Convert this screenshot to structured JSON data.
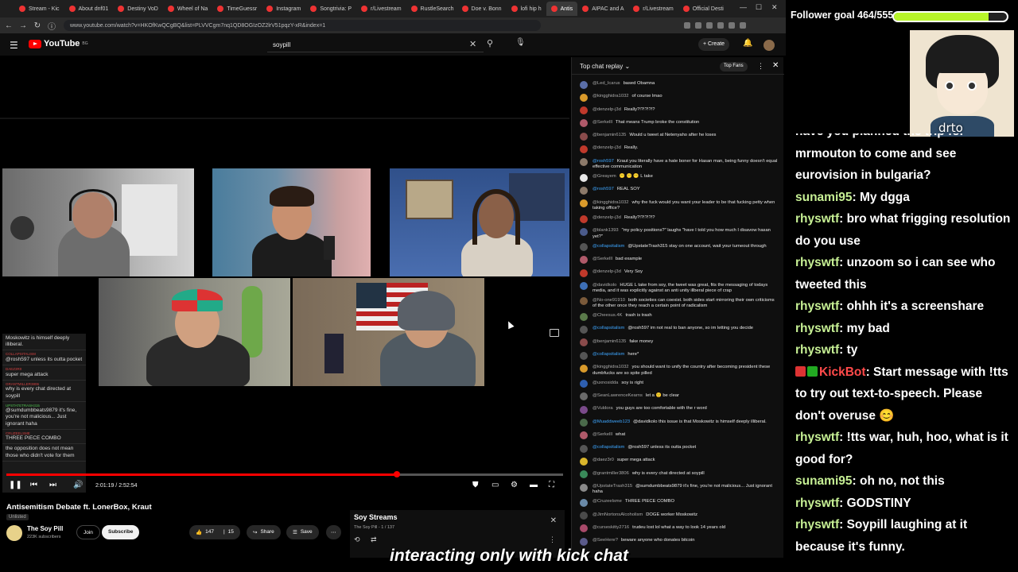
{
  "browser": {
    "tabs": [
      "Stream - Kic",
      "About dnf01",
      "Destiny VoD",
      "Wheel of Na",
      "TimeGuessr",
      "Instagram",
      "Songtrivia: P",
      "r/Livestream",
      "RustleSearch",
      "Doe v. Bonn",
      "lofi hip h",
      "Antis",
      "AIPAC and A",
      "r/Livestream",
      "Official Desti"
    ],
    "active_tab_index": 11,
    "url": "www.youtube.com/watch?v=HKOfKwQCgBQ&list=PLVVCgm7nq1QD8OGIzOZ2lrV51pqzY-xR&index=1"
  },
  "youtube": {
    "logo": "YouTube",
    "country": "BG",
    "search_value": "soypill",
    "create_label": "Create"
  },
  "video": {
    "time_current": "2:01:19",
    "time_total": "2:52:54",
    "progress": 0.701,
    "overlay_chat": [
      {
        "user": "",
        "text": "Moskowitz is himself deeply illiberal.",
        "member": false
      },
      {
        "user": "COLLAPSITALISM",
        "text": "@rosh597 unless its outta pocket",
        "member": false
      },
      {
        "user": "DAEZ3R0",
        "text": "super mega attack",
        "member": false
      },
      {
        "user": "GRANTMILLER3806",
        "text": "why is every chat directed at soypill",
        "member": false
      },
      {
        "user": "UPSTATETRASH315",
        "text": "@sumdumbbeats9879 it's fine, you're not malicious... Just ignorant haha",
        "member": true
      },
      {
        "user": "CRUZEELSME",
        "text": "THREE PIECE COMBO",
        "member": false
      },
      {
        "user": "",
        "text": "the opposition does not mean those who didn't vote for them",
        "member": false
      }
    ],
    "title": "Antisemitism Debate ft. LonerBox, Kraut",
    "visibility": "Unlisted",
    "channel_name": "The Soy Pill",
    "channel_subs": "223K subscribers",
    "join_label": "Join",
    "subscribe_label": "Subscribe",
    "likes": "147",
    "dislikes": "15",
    "share_label": "Share",
    "save_label": "Save"
  },
  "playlist": {
    "title": "Soy Streams",
    "subtitle": "The Soy Pill - 1 / 137"
  },
  "chat_replay": {
    "mode": "Top chat replay",
    "top_fans_label": "Top Fans",
    "messages": [
      {
        "author": "@Led_Icarus",
        "text": "based Obamna",
        "color": "#5a6ea8",
        "member": false
      },
      {
        "author": "@kingghidra1032",
        "text": "of course lmao",
        "color": "#d99a2b",
        "member": false
      },
      {
        "author": "@denzelp-j3d",
        "text": "Really?!?!?!?!?",
        "color": "#c0392b",
        "member": false
      },
      {
        "author": "@Serkelll",
        "text": "That means Trump broke the constitution",
        "color": "#b05a6a",
        "member": false
      },
      {
        "author": "@benjamin6135",
        "text": "Would u tweet at Netenyaho after he loses",
        "color": "#8a4b4b",
        "member": false
      },
      {
        "author": "@denzelp-j3d",
        "text": "Really.",
        "color": "#c0392b",
        "member": false
      },
      {
        "author": "@rosh597",
        "text": "Kraut you literally have a hate boner for Hasan man, being funny doesn't equal effective communication",
        "color": "#8d7a6a",
        "member": true
      },
      {
        "author": "@Greayem",
        "text": "😶 😶 😶 L take",
        "color": "#e8e8e8",
        "member": false
      },
      {
        "author": "@rosh597",
        "text": "REAL SOY",
        "color": "#8d7a6a",
        "member": true
      },
      {
        "author": "@kingghidra1032",
        "text": "why the fuck would you want your leader to be that fucking petty when taking office?",
        "color": "#d99a2b",
        "member": false
      },
      {
        "author": "@denzelp-j3d",
        "text": "Really?!?!?!?!?",
        "color": "#c0392b",
        "member": false
      },
      {
        "author": "@blank1393",
        "text": "\"my policy positions?\" laughs \"have I told you how much I disavow hasan yet?\"",
        "color": "#4a5a8a",
        "member": false
      },
      {
        "author": "@collapsitalism",
        "text": "@UpstateTrash315 stay on one account, wait your turneout through",
        "color": "#555555",
        "member": true
      },
      {
        "author": "@Serkelll",
        "text": "bad example",
        "color": "#b05a6a",
        "member": false
      },
      {
        "author": "@denzelp-j3d",
        "text": "Very Soy",
        "color": "#c0392b",
        "member": false
      },
      {
        "author": "@davidkolo",
        "text": "HUGE L take from soy, the tweet was great, fits the messaging of todays media, and it was explicitly against an anti unity illberal piece of crap",
        "color": "#3d6fb6",
        "member": false
      },
      {
        "author": "@No-one91910",
        "text": "both societies can coexist. both sides start mirroring their own criticisms of the other once they reach a certain point of radicalism",
        "color": "#7a5a3a",
        "member": false
      },
      {
        "author": "@Cheesus.4K",
        "text": "trash is trash",
        "color": "#5a7a4a",
        "member": false
      },
      {
        "author": "@collapsitalism",
        "text": "@rosh597 im not real to ban anyone, so im letting you decide",
        "color": "#555555",
        "member": true
      },
      {
        "author": "@benjamin6135",
        "text": "fake money",
        "color": "#8a4b4b",
        "member": false
      },
      {
        "author": "@collapsitalism",
        "text": "here*",
        "color": "#555555",
        "member": true
      },
      {
        "author": "@kingghidra1032",
        "text": "you should want to unify the country after becoming president these dumbfucks are so spite pilled",
        "color": "#d99a2b",
        "member": false
      },
      {
        "author": "@uxnosidda",
        "text": "soy is right",
        "color": "#2e5fb0",
        "member": false
      },
      {
        "author": "@SeanLawrenceKearns",
        "text": "let a 🙂 be clear",
        "color": "#6a6a6a",
        "member": false
      },
      {
        "author": "@Vuldora",
        "text": "you guys are too comfortable with the r word",
        "color": "#7a4a8a",
        "member": false
      },
      {
        "author": "@Muaddweeb123",
        "text": "@davidkolo this issue is that Moskowitz is himself deeply illiberal.",
        "color": "#4a6a4a",
        "member": true
      },
      {
        "author": "@Serkelll",
        "text": "what",
        "color": "#b05a6a",
        "member": false
      },
      {
        "author": "@collapsitalism",
        "text": "@rosh597 unless its outta pocket",
        "color": "#555555",
        "member": true
      },
      {
        "author": "@daez3r0",
        "text": "super mega attack",
        "color": "#d9b52b",
        "member": false
      },
      {
        "author": "@grantmiller3806",
        "text": "why is every chat directed at soypill",
        "color": "#3a8a5a",
        "member": false
      },
      {
        "author": "@UpstateTrash315",
        "text": "@sumdumbbeats9879 it's fine, you're not malicious... Just ignorant haha",
        "color": "#8a8a8a",
        "member": false
      },
      {
        "author": "@Cruzeelsme",
        "text": "THREE PIECE COMBO",
        "color": "#6a8aa8",
        "member": false
      },
      {
        "author": "@JimNortonsAlcoholism",
        "text": "DOGE worker Moskowitz",
        "color": "#4a4a4a",
        "member": false
      },
      {
        "author": "@curseskitty2716",
        "text": "trudeu lost lol what a way to look 14 years old",
        "color": "#a84a6a",
        "member": false
      },
      {
        "author": "@SeeHere?",
        "text": "beware anyone who donates bitcoin",
        "color": "#5a5a8a",
        "member": false
      }
    ]
  },
  "stream_overlay": {
    "goal_label": "Follower goal 464/555",
    "goal_current": 464,
    "goal_target": 555,
    "goal_color": "#b7f52a",
    "portrait_tag": "drto",
    "chat": [
      {
        "user": "",
        "text": "have you planned the trip for mrmouton to come and see eurovision in bulgaria?"
      },
      {
        "user": "sunami95",
        "text": "My dgga"
      },
      {
        "user": "rhyswtf",
        "text": "bro what frigging resolution do you use"
      },
      {
        "user": "rhyswtf",
        "text": "unzoom so i can see who tweeted this"
      },
      {
        "user": "rhyswtf",
        "text": "ohhh it's a screenshare"
      },
      {
        "user": "rhyswtf",
        "text": "my bad"
      },
      {
        "user": "rhyswtf",
        "text": "ty"
      },
      {
        "user": "KickBot",
        "text": "Start message with !tts to try out text-to-speech. Please don't overuse 😊",
        "bot": true
      },
      {
        "user": "rhyswtf",
        "text": "!tts war, huh, hoo, what is it good for?"
      },
      {
        "user": "sunami95",
        "text": "oh no, not this"
      },
      {
        "user": "rhyswtf",
        "text": "GODSTINY"
      },
      {
        "user": "rhyswtf",
        "text": "Soypill laughing at it because it's funny."
      }
    ]
  },
  "caption": "interacting only with kick chat"
}
